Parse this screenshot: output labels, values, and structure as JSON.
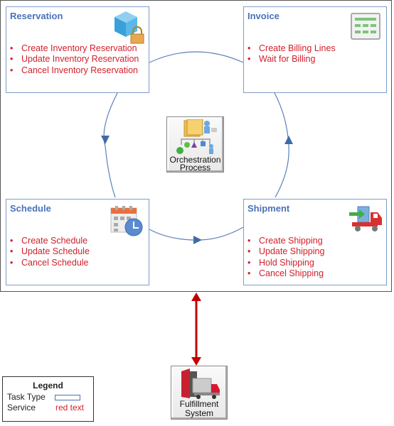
{
  "tasks": {
    "reservation": {
      "title": "Reservation",
      "icon": "inventory-lock-icon",
      "services": [
        "Create Inventory  Reservation",
        "Update Inventory Reservation",
        "Cancel Inventory Reservation"
      ]
    },
    "invoice": {
      "title": "Invoice",
      "icon": "billing-table-icon",
      "services": [
        "Create Billing Lines",
        "Wait for Billing"
      ]
    },
    "schedule": {
      "title": "Schedule",
      "icon": "calendar-clock-icon",
      "services": [
        "Create Schedule",
        "Update Schedule",
        "Cancel Schedule"
      ]
    },
    "shipment": {
      "title": "Shipment",
      "icon": "shipping-truck-icon",
      "services": [
        "Create Shipping",
        "Update Shipping",
        "Hold Shipping",
        "Cancel Shipping"
      ]
    }
  },
  "center": {
    "line1": "Orchestration",
    "line2": "Process",
    "icon": "orchestration-process-icon"
  },
  "fulfillment": {
    "line1": "Fulfillment",
    "line2": "System",
    "icon": "fulfillment-truck-icon"
  },
  "legend": {
    "title": "Legend",
    "task_type_label": "Task Type",
    "service_label": "Service",
    "service_sample": "red text"
  },
  "colors": {
    "task_border": "#7f9cc9",
    "task_title": "#4a72b8",
    "service_text": "#d0202a",
    "connector": "#4a72b8",
    "integration_arrow": "#c00000"
  }
}
